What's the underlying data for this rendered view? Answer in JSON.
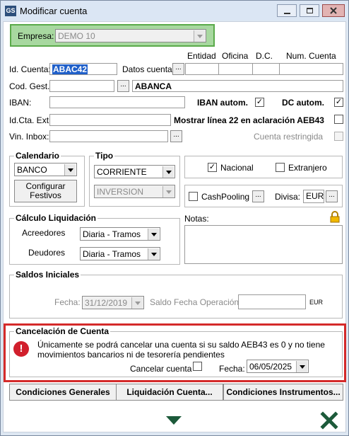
{
  "window": {
    "title": "Modificar cuenta",
    "app_icon_text": "GS"
  },
  "empresa": {
    "label": "Empresa:",
    "value": "DEMO 10"
  },
  "column_headers": {
    "entidad": "Entidad",
    "oficina": "Oficina",
    "dc": "D.C.",
    "num_cuenta": "Num. Cuenta"
  },
  "form": {
    "id_cuenta_label": "Id. Cuenta:",
    "id_cuenta_value": "ABAC42",
    "datos_cuenta_label": "Datos cuenta:",
    "cod_gest_label": "Cod. Gest.:",
    "bank_name": "ABANCA",
    "iban_label": "IBAN:",
    "iban_autom_label": "IBAN autom.",
    "iban_autom_checked": true,
    "dc_autom_label": "DC autom.",
    "dc_autom_checked": true,
    "id_cta_ext_label": "Id.Cta. Ext.",
    "mostrar_linea_label": "Mostrar línea 22 en aclaración AEB43",
    "mostrar_linea_checked": false,
    "vin_inbox_label": "Vin. Inbox:",
    "cuenta_restringida_label": "Cuenta restringida",
    "ellipsis": "..."
  },
  "calendario": {
    "title": "Calendario",
    "value": "BANCO",
    "configurar_line1": "Configurar",
    "configurar_line2": "Festivos"
  },
  "tipo": {
    "title": "Tipo",
    "value1": "CORRIENTE",
    "value2": "INVERSION"
  },
  "nacional": {
    "nacional_label": "Nacional",
    "nacional_checked": true,
    "extranjero_label": "Extranjero",
    "extranjero_checked": false
  },
  "cash": {
    "cashpooling_label": "CashPooling",
    "divisa_label": "Divisa:",
    "divisa_value": "EUR"
  },
  "calculo": {
    "title": "Cálculo Liquidación",
    "acreedores_label": "Acreedores",
    "acreedores_value": "Diaria - Tramos",
    "deudores_label": "Deudores",
    "deudores_value": "Diaria - Tramos"
  },
  "notas": {
    "label": "Notas:"
  },
  "saldos": {
    "title": "Saldos Iniciales",
    "fecha_label": "Fecha:",
    "fecha_value": "31/12/2019",
    "saldo_label": "Saldo Fecha Operación:",
    "currency": "EUR"
  },
  "cancelacion": {
    "title": "Cancelación de Cuenta",
    "message_line1": "Únicamente se podrá cancelar una cuenta si su saldo AEB43 es 0 y no tiene",
    "message_line2": "movimientos bancarios ni de tesorería pendientes",
    "cancelar_label": "Cancelar cuenta",
    "cancelar_checked": false,
    "fecha_label": "Fecha:",
    "fecha_value": "06/05/2025"
  },
  "buttons": {
    "condiciones_generales": "Condiciones Generales",
    "liquidacion_cuenta": "Liquidación Cuenta...",
    "condiciones_instrumentos": "Condiciones Instrumentos..."
  },
  "colors": {
    "accent_border": "#d42a2a",
    "title_bar": "#dbe6f4",
    "empresa_bg": "#a8d8a0"
  }
}
